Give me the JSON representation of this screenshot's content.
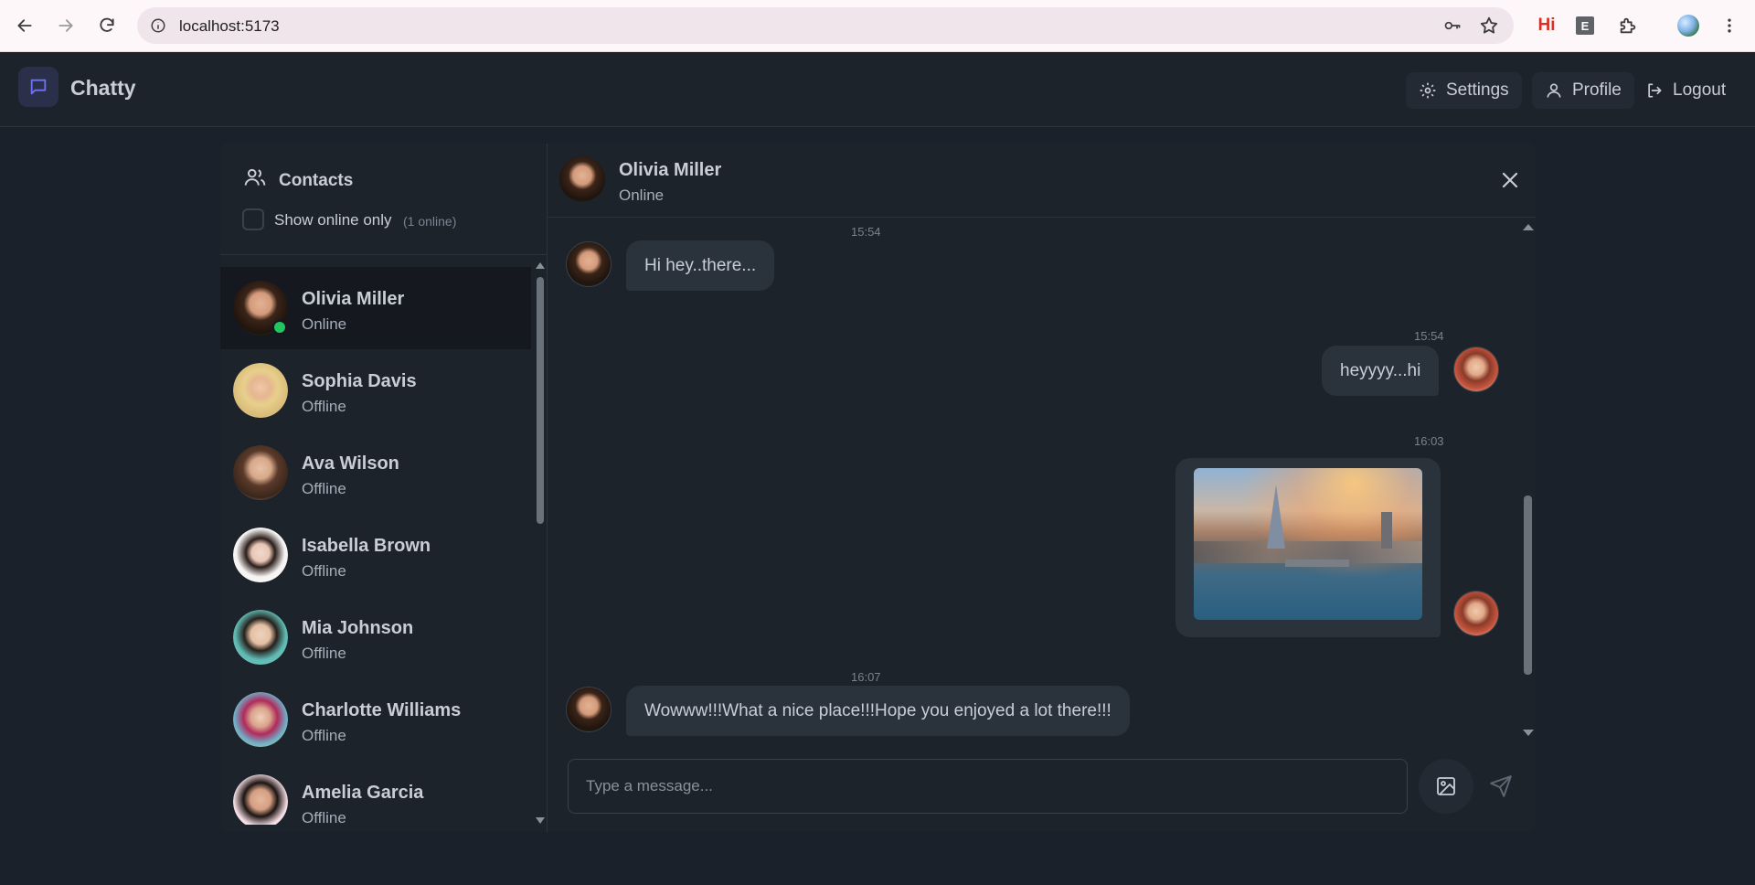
{
  "browser": {
    "url": "localhost:5173",
    "ext_hi": "Hi",
    "ext_e": "E"
  },
  "navbar": {
    "brand": "Chatty",
    "settings_label": "Settings",
    "profile_label": "Profile",
    "logout_label": "Logout",
    "accent_color": "#6d72f6"
  },
  "sidebar": {
    "title": "Contacts",
    "filter_label": "Show online only",
    "online_count": "(1 online)",
    "filter_checked": false,
    "contacts": [
      {
        "name": "Olivia Miller",
        "status": "Online",
        "active": true,
        "online": true
      },
      {
        "name": "Sophia Davis",
        "status": "Offline"
      },
      {
        "name": "Ava Wilson",
        "status": "Offline"
      },
      {
        "name": "Isabella Brown",
        "status": "Offline"
      },
      {
        "name": "Mia Johnson",
        "status": "Offline"
      },
      {
        "name": "Charlotte Williams",
        "status": "Offline"
      },
      {
        "name": "Amelia Garcia",
        "status": "Offline"
      }
    ]
  },
  "chat": {
    "name": "Olivia Miller",
    "status": "Online",
    "messages": [
      {
        "time": "15:54",
        "text": "Hi hey..there...",
        "side": "left"
      },
      {
        "time": "15:54",
        "text": "heyyyy...hi",
        "side": "right"
      },
      {
        "time": "16:03",
        "image": "city-river-photo",
        "side": "right"
      },
      {
        "time": "16:07",
        "text": "Wowww!!!What a nice place!!!Hope you enjoyed a lot there!!!",
        "side": "left"
      }
    ],
    "input_placeholder": "Type a message...",
    "input_value": ""
  },
  "colors": {
    "online": "#22c55e",
    "bubble": "#2a323c",
    "background": "#1d232a"
  }
}
